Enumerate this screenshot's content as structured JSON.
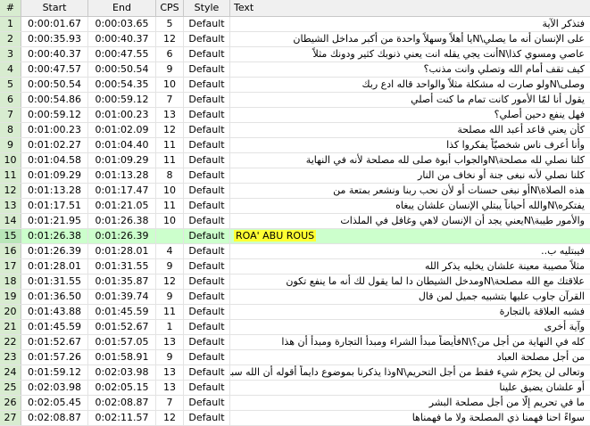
{
  "columns": [
    "#",
    "Start",
    "End",
    "CPS",
    "Style",
    "Text"
  ],
  "rows": [
    {
      "n": "1",
      "start": "0:00:01.67",
      "end": "0:00:03.65",
      "cps": "5",
      "style": "Default",
      "text": "فتذكر الآية"
    },
    {
      "n": "2",
      "start": "0:00:35.93",
      "end": "0:00:40.37",
      "cps": "12",
      "style": "Default",
      "text": "على الإنسان أنه ما يصلي\\Nيا أهلاً وسهلاً واحدة من أكبر مداخل الشيطان"
    },
    {
      "n": "3",
      "start": "0:00:40.37",
      "end": "0:00:47.55",
      "cps": "6",
      "style": "Default",
      "text": "عاصي ومسوي كذا\\Nأنت يجي يقله انت يعني ذنوبك كثير ودونك مثلاً"
    },
    {
      "n": "4",
      "start": "0:00:47.57",
      "end": "0:00:50.54",
      "cps": "9",
      "style": "Default",
      "text": "كيف تقف أمام الله وتصلي وانت مذنب؟"
    },
    {
      "n": "5",
      "start": "0:00:50.54",
      "end": "0:00:54.35",
      "cps": "10",
      "style": "Default",
      "text": "وصلى\\Nولو صارت له مشكلة مثلاً والواحد قاله ادع ربك"
    },
    {
      "n": "6",
      "start": "0:00:54.86",
      "end": "0:00:59.12",
      "cps": "7",
      "style": "Default",
      "text": "يقول أنا لمّا الأمور كانت تمام ما كنت أصلي"
    },
    {
      "n": "7",
      "start": "0:00:59.12",
      "end": "0:01:00.23",
      "cps": "13",
      "style": "Default",
      "text": "فهل ينفع دحين أصلي؟"
    },
    {
      "n": "8",
      "start": "0:01:00.23",
      "end": "0:01:02.09",
      "cps": "12",
      "style": "Default",
      "text": "كأن يعني قاعد أعبد الله مصلحة"
    },
    {
      "n": "9",
      "start": "0:01:02.27",
      "end": "0:01:04.40",
      "cps": "11",
      "style": "Default",
      "text": "وأنا أعرف ناس شخصيّاً يفكروا كذا"
    },
    {
      "n": "10",
      "start": "0:01:04.58",
      "end": "0:01:09.29",
      "cps": "11",
      "style": "Default",
      "text": "كلنا نصلي لله مصلحة\\Nوالجواب أبوة صلى لله مصلحة لأنه في النهاية"
    },
    {
      "n": "11",
      "start": "0:01:09.29",
      "end": "0:01:13.28",
      "cps": "8",
      "style": "Default",
      "text": "كلنا نصلي لأنه نبغى جنة أو نخاف من النار"
    },
    {
      "n": "12",
      "start": "0:01:13.28",
      "end": "0:01:17.47",
      "cps": "10",
      "style": "Default",
      "text": "هذه الصلاة\\Nأو نبغى حسنات أو لأن نحب ربنا ونشعر بمتعة من"
    },
    {
      "n": "13",
      "start": "0:01:17.51",
      "end": "0:01:21.05",
      "cps": "11",
      "style": "Default",
      "text": "يفتكره\\Nوالله أحياناً يبتلي الإنسان علشان يبغاه"
    },
    {
      "n": "14",
      "start": "0:01:21.95",
      "end": "0:01:26.38",
      "cps": "10",
      "style": "Default",
      "text": "والأمور طيبة\\Nيعني يجد أن الإنسان لاهي وغافل في الملذات"
    },
    {
      "n": "15",
      "start": "0:01:26.38",
      "end": "0:01:26.39",
      "cps": "",
      "style": "Default",
      "text": "ROA' ABU ROUS"
    },
    {
      "n": "16",
      "start": "0:01:26.39",
      "end": "0:01:28.01",
      "cps": "4",
      "style": "Default",
      "text": "فيبتليه ب.."
    },
    {
      "n": "17",
      "start": "0:01:28.01",
      "end": "0:01:31.55",
      "cps": "9",
      "style": "Default",
      "text": "مثلاً مصيبة معينة علشان يخليه يذكر الله"
    },
    {
      "n": "18",
      "start": "0:01:31.55",
      "end": "0:01:35.87",
      "cps": "12",
      "style": "Default",
      "text": "علاقتك مع الله مصلحة\\Nومدخل الشيطان دا لما يقول لك أنه ما ينفع تكون"
    },
    {
      "n": "19",
      "start": "0:01:36.50",
      "end": "0:01:39.74",
      "cps": "9",
      "style": "Default",
      "text": "القرآن جاوب عليها بتشبيه جميل لمن قال"
    },
    {
      "n": "20",
      "start": "0:01:43.88",
      "end": "0:01:45.59",
      "cps": "11",
      "style": "Default",
      "text": "فشبه العلاقة بالتجارة"
    },
    {
      "n": "21",
      "start": "0:01:45.59",
      "end": "0:01:52.67",
      "cps": "1",
      "style": "Default",
      "text": "وآية أخرى"
    },
    {
      "n": "22",
      "start": "0:01:52.67",
      "end": "0:01:57.05",
      "cps": "13",
      "style": "Default",
      "text": "كله في النهاية من أجل من؟\\Nفأيضاً مبدأ الشراء ومبدأ التجارة ومبدأ أن هذا"
    },
    {
      "n": "23",
      "start": "0:01:57.26",
      "end": "0:01:58.91",
      "cps": "9",
      "style": "Default",
      "text": "من أجل مصلحة العباد"
    },
    {
      "n": "24",
      "start": "0:01:59.12",
      "end": "0:02:03.98",
      "cps": "13",
      "style": "Default",
      "text": "وتعالى لن يحرّم شيء فقط من أجل التحريم\\Nوذا يذكرنا بموضوع دايماً أقوله أن الله سبحانه"
    },
    {
      "n": "25",
      "start": "0:02:03.98",
      "end": "0:02:05.15",
      "cps": "13",
      "style": "Default",
      "text": "أو علشان يضيق علينا"
    },
    {
      "n": "26",
      "start": "0:02:05.45",
      "end": "0:02:08.87",
      "cps": "7",
      "style": "Default",
      "text": "ما في تحريم إلّا من أجل مصلحة البشر"
    },
    {
      "n": "27",
      "start": "0:02:08.87",
      "end": "0:02:11.57",
      "cps": "12",
      "style": "Default",
      "text": "سواءً احنا فهمنا ذي المصلحة ولا ما فهمناها"
    }
  ],
  "selected_row": "15",
  "colors": {
    "selected_bg": "#ccffcc",
    "highlight": "#ffff33",
    "number_col_bg": "#d8ecd0"
  }
}
